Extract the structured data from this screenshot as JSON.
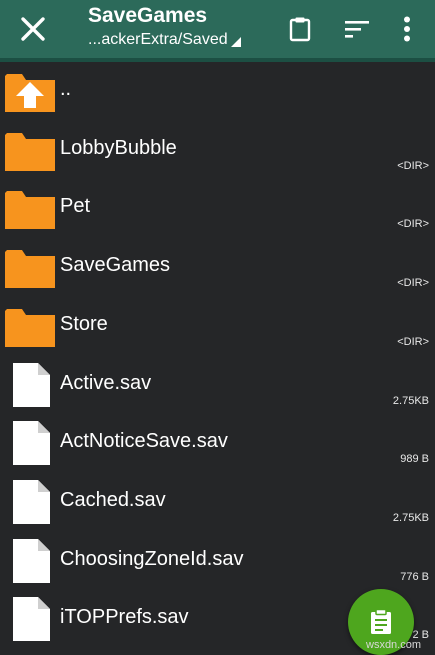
{
  "toolbar": {
    "title": "SaveGames",
    "path": "...ackerExtra/Saved",
    "close_icon": "close-icon",
    "clipboard_icon": "clipboard-icon",
    "sort_icon": "sort-icon",
    "more_icon": "more-vert-icon"
  },
  "files": [
    {
      "name": "..",
      "meta": "",
      "kind": "parent"
    },
    {
      "name": "LobbyBubble",
      "meta": "<DIR>",
      "kind": "folder"
    },
    {
      "name": "Pet",
      "meta": "<DIR>",
      "kind": "folder"
    },
    {
      "name": "SaveGames",
      "meta": "<DIR>",
      "kind": "folder"
    },
    {
      "name": "Store",
      "meta": "<DIR>",
      "kind": "folder"
    },
    {
      "name": "Active.sav",
      "meta": "2.75KB",
      "kind": "file"
    },
    {
      "name": "ActNoticeSave.sav",
      "meta": "989 B",
      "kind": "file"
    },
    {
      "name": "Cached.sav",
      "meta": "2.75KB",
      "kind": "file"
    },
    {
      "name": "ChoosingZoneId.sav",
      "meta": "776 B",
      "kind": "file"
    },
    {
      "name": "iTOPPrefs.sav",
      "meta": "2 B",
      "kind": "file"
    }
  ],
  "fab": {
    "icon": "paste-icon"
  },
  "watermark": "wsxdn.com",
  "colors": {
    "toolbar": "#2c6a5a",
    "background": "#252628",
    "folder": "#f7941e",
    "fab": "#4ea61e"
  }
}
